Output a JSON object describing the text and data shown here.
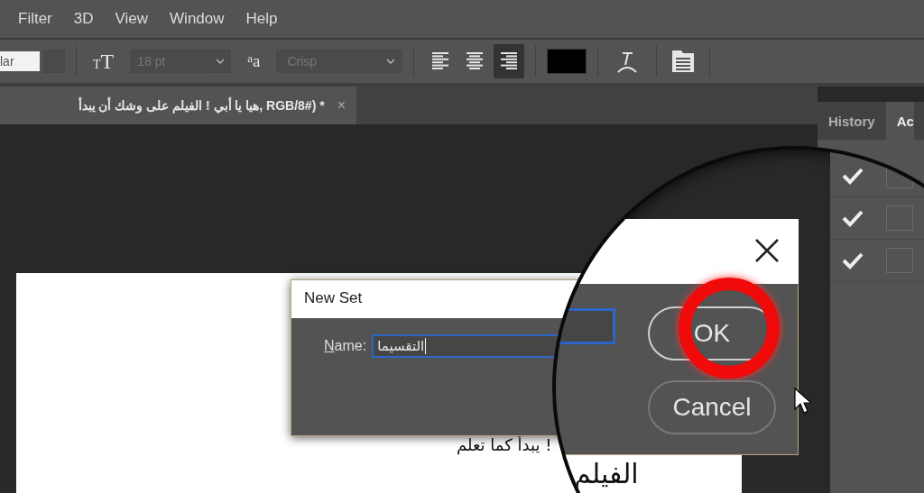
{
  "menu_bar": {
    "items": [
      "Filter",
      "3D",
      "View",
      "Window",
      "Help"
    ]
  },
  "options_bar": {
    "font_style": "lar",
    "size_glyphs": [
      "T",
      "T"
    ],
    "font_size": "18 pt",
    "antialias_glyphs": [
      "a",
      "a"
    ],
    "antialias": "Crisp",
    "alignment": [
      {
        "kind": "left",
        "selected": false
      },
      {
        "kind": "center",
        "selected": false
      },
      {
        "kind": "right",
        "selected": true
      }
    ]
  },
  "document_tab": {
    "title": "هيا يا أبي ! الفيلم على وشك أن يبدأ, RGB/8#) *",
    "close": "×"
  },
  "panel": {
    "tabs": [
      {
        "label": "History",
        "selected": false
      },
      {
        "label": "Ac",
        "selected": true
      }
    ],
    "rows": [
      {
        "checked": true
      },
      {
        "checked": true
      },
      {
        "checked": true
      }
    ]
  },
  "canvas_text": "يبدأ كما تعلم !",
  "dialog": {
    "title": "New Set",
    "name_label": "Name:",
    "name_value": "التقسيما"
  },
  "magnifier": {
    "buttons": [
      {
        "label": "OK",
        "highlighted": true
      },
      {
        "label": "Cancel",
        "highlighted": false
      }
    ],
    "canvas_text": "الفيلم"
  }
}
